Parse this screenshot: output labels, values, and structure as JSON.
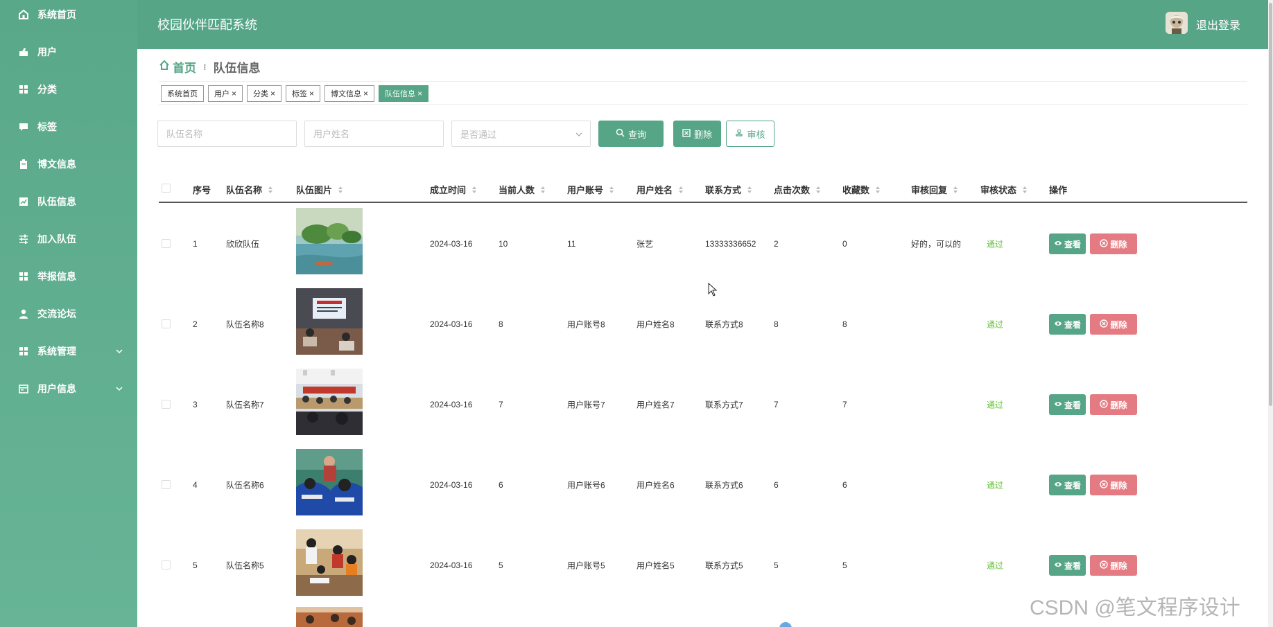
{
  "app": {
    "title": "校园伙伴匹配系统",
    "logout": "退出登录"
  },
  "sidebar": {
    "items": [
      {
        "label": "系统首页",
        "icon": "home-icon"
      },
      {
        "label": "用户",
        "icon": "user-icon"
      },
      {
        "label": "分类",
        "icon": "grid-icon"
      },
      {
        "label": "标签",
        "icon": "comment-icon"
      },
      {
        "label": "博文信息",
        "icon": "clipboard-icon"
      },
      {
        "label": "队伍信息",
        "icon": "chart-icon"
      },
      {
        "label": "加入队伍",
        "icon": "sliders-icon"
      },
      {
        "label": "举报信息",
        "icon": "grid-icon"
      },
      {
        "label": "交流论坛",
        "icon": "person-icon"
      },
      {
        "label": "系统管理",
        "icon": "grid-icon",
        "expandable": true
      },
      {
        "label": "用户信息",
        "icon": "card-icon",
        "expandable": true
      }
    ]
  },
  "breadcrumb": {
    "home": "首页",
    "separator": "⁝",
    "current": "队伍信息"
  },
  "tags": [
    {
      "label": "系统首页",
      "closable": false,
      "active": false
    },
    {
      "label": "用户",
      "closable": true,
      "active": false
    },
    {
      "label": "分类",
      "closable": true,
      "active": false
    },
    {
      "label": "标签",
      "closable": true,
      "active": false
    },
    {
      "label": "博文信息",
      "closable": true,
      "active": false
    },
    {
      "label": "队伍信息",
      "closable": true,
      "active": true
    }
  ],
  "search": {
    "team_name_placeholder": "队伍名称",
    "user_name_placeholder": "用户姓名",
    "approved_placeholder": "是否通过",
    "query_label": "查询",
    "delete_label": "删除",
    "audit_label": "审核"
  },
  "table": {
    "columns": [
      "序号",
      "队伍名称",
      "队伍图片",
      "成立时间",
      "当前人数",
      "用户账号",
      "用户姓名",
      "联系方式",
      "点击次数",
      "收藏数",
      "审核回复",
      "审核状态",
      "操作"
    ],
    "view_label": "查看",
    "delete_label": "删除",
    "rows": [
      {
        "index": "1",
        "team_name": "欣欣队伍",
        "founded": "2024-03-16",
        "members": "10",
        "account": "11",
        "user_name": "张艺",
        "contact": "13333336652",
        "clicks": "2",
        "favorites": "0",
        "reply": "好的，可以的",
        "status": "通过",
        "image": "lake-landscape"
      },
      {
        "index": "2",
        "team_name": "队伍名称8",
        "founded": "2024-03-16",
        "members": "8",
        "account": "用户账号8",
        "user_name": "用户姓名8",
        "contact": "联系方式8",
        "clicks": "8",
        "favorites": "8",
        "reply": "",
        "status": "通过",
        "image": "meeting-room"
      },
      {
        "index": "3",
        "team_name": "队伍名称7",
        "founded": "2024-03-16",
        "members": "7",
        "account": "用户账号7",
        "user_name": "用户姓名7",
        "contact": "联系方式7",
        "clicks": "7",
        "favorites": "7",
        "reply": "",
        "status": "通过",
        "image": "conference-hall"
      },
      {
        "index": "4",
        "team_name": "队伍名称6",
        "founded": "2024-03-16",
        "members": "6",
        "account": "用户账号6",
        "user_name": "用户姓名6",
        "contact": "联系方式6",
        "clicks": "6",
        "favorites": "6",
        "reply": "",
        "status": "通过",
        "image": "students-blue"
      },
      {
        "index": "5",
        "team_name": "队伍名称5",
        "founded": "2024-03-16",
        "members": "5",
        "account": "用户账号5",
        "user_name": "用户姓名5",
        "contact": "联系方式5",
        "clicks": "5",
        "favorites": "5",
        "reply": "",
        "status": "通过",
        "image": "classroom-group"
      }
    ]
  },
  "watermark": "CSDN @笔文程序设计",
  "colors": {
    "primary": "#56a587",
    "danger": "#e57b82",
    "success": "#67c23a"
  }
}
